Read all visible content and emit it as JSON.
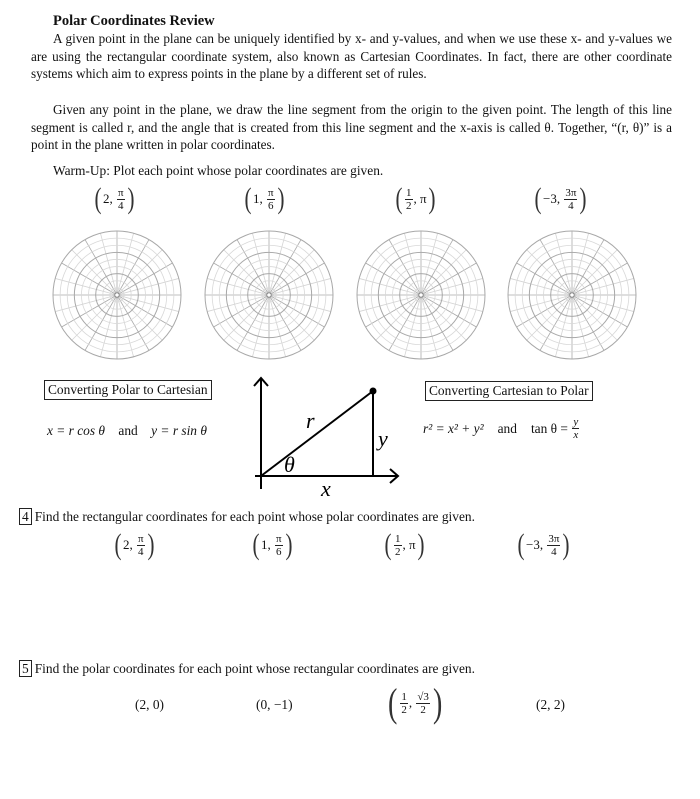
{
  "header": {
    "title": "Polar Coordinates Review"
  },
  "intro": {
    "paragraph1": "A given point in the plane can be uniquely identified by x- and y-values, and when we use these x- and y-values we are using the rectangular coordinate system, also known as Cartesian Coordinates. In fact, there are other coordinate systems which aim to express points in the plane by a different set of rules.",
    "paragraph2": "Given any point in the plane, we draw the line segment from the origin to the given point. The length of this line segment is called r, and the angle that is created from this line segment and the x-axis is called θ. Together, “(r, θ)” is a point in the plane written in polar coordinates."
  },
  "warmup": {
    "instruction": "Warm-Up: Plot each point whose polar coordinates are given.",
    "points": [
      {
        "r": "2",
        "theta_num": "π",
        "theta_den": "4"
      },
      {
        "r": "1",
        "theta_num": "π",
        "theta_den": "6"
      },
      {
        "r_num": "1",
        "r_den": "2",
        "theta": "π"
      },
      {
        "r": "−3",
        "theta_num": "3π",
        "theta_den": "4"
      }
    ],
    "polar_grid": {
      "rings": 9,
      "major_ring_every": 3,
      "spokes_deg": 15,
      "major_spoke_deg": 30,
      "count": 4
    }
  },
  "formulas": {
    "polar_to_cartesian": {
      "label": "Converting Polar to Cartesian",
      "formula_x": "x = r cos θ",
      "connector": "and",
      "formula_y": "y = r sin θ"
    },
    "cartesian_to_polar": {
      "label": "Converting Cartesian to Polar",
      "formula_r": "r² = x² + y²",
      "connector": "and",
      "formula_tan_left": "tan θ =",
      "formula_tan_num": "y",
      "formula_tan_den": "x"
    },
    "diagram": {
      "label_r": "r",
      "label_theta": "θ",
      "label_x": "x",
      "label_y": "y"
    }
  },
  "problem4": {
    "number": "4",
    "instruction": "Find the rectangular coordinates for each point whose polar coordinates are given.",
    "points": [
      {
        "r": "2",
        "theta_num": "π",
        "theta_den": "4"
      },
      {
        "r": "1",
        "theta_num": "π",
        "theta_den": "6"
      },
      {
        "r_num": "1",
        "r_den": "2",
        "theta": "π"
      },
      {
        "r": "−3",
        "theta_num": "3π",
        "theta_den": "4"
      }
    ]
  },
  "problem5": {
    "number": "5",
    "instruction": "Find the polar coordinates for each point whose rectangular coordinates are given.",
    "points": [
      {
        "text": "(2, 0)"
      },
      {
        "text": "(0, −1)"
      },
      {
        "x_num": "1",
        "x_den": "2",
        "y_num": "√3",
        "y_den": "2"
      },
      {
        "text": "(2, 2)"
      }
    ]
  }
}
